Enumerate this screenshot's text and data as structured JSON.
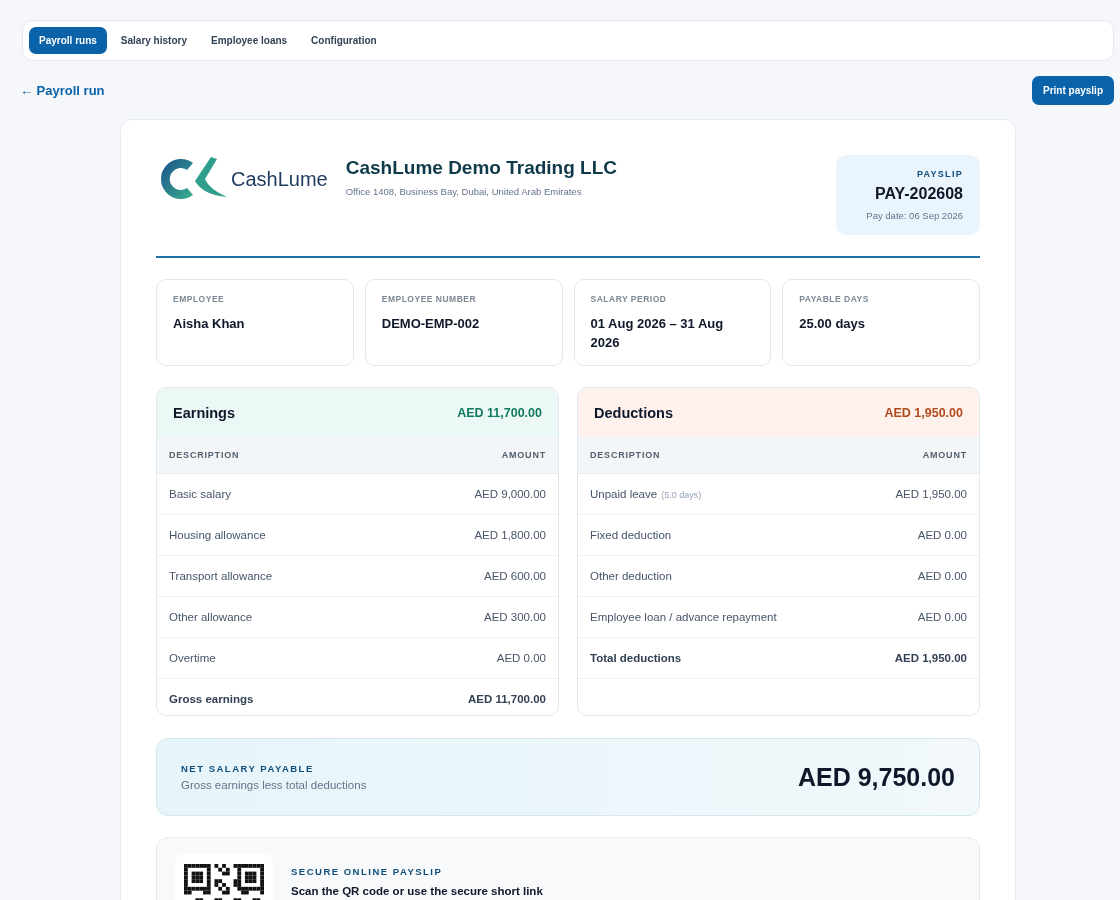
{
  "tabs": [
    {
      "label": "Payroll runs",
      "selected": true
    },
    {
      "label": "Salary history",
      "selected": false
    },
    {
      "label": "Employee loans",
      "selected": false
    },
    {
      "label": "Configuration",
      "selected": false
    }
  ],
  "back_link": "← Payroll run",
  "print_button": "Print payslip",
  "company": {
    "logo_text": "CashLume",
    "name": "CashLume Demo Trading LLC",
    "address": "Office 1408, Business Bay, Dubai, United Arab Emirates"
  },
  "payslip": {
    "label": "PAYSLIP",
    "number": "PAY-202608",
    "pay_date": "Pay date: 06 Sep 2026"
  },
  "info": [
    {
      "label": "EMPLOYEE",
      "value": "Aisha Khan"
    },
    {
      "label": "EMPLOYEE NUMBER",
      "value": "DEMO-EMP-002"
    },
    {
      "label": "SALARY PERIOD",
      "value": "01 Aug 2026 – 31 Aug 2026"
    },
    {
      "label": "PAYABLE DAYS",
      "value": "25.00 days"
    }
  ],
  "panels": [
    {
      "kind": "earnings",
      "title": "Earnings",
      "total": "AED 11,700.00",
      "columns": [
        "DESCRIPTION",
        "AMOUNT"
      ],
      "rows": [
        {
          "kind": "item",
          "description": "Basic salary",
          "amount": "AED 9,000.00"
        },
        {
          "kind": "item",
          "description": "Housing allowance",
          "amount": "AED 1,800.00"
        },
        {
          "kind": "item",
          "description": "Transport allowance",
          "amount": "AED 600.00"
        },
        {
          "kind": "item",
          "description": "Other allowance",
          "amount": "AED 300.00"
        },
        {
          "kind": "item",
          "description": "Overtime",
          "amount": "AED 0.00"
        },
        {
          "kind": "total",
          "description": "Gross earnings",
          "amount": "AED 11,700.00"
        }
      ]
    },
    {
      "kind": "deductions",
      "title": "Deductions",
      "total": "AED 1,950.00",
      "columns": [
        "DESCRIPTION",
        "AMOUNT"
      ],
      "rows": [
        {
          "kind": "item",
          "description": "Unpaid leave",
          "note": "(5.0 days)",
          "amount": "AED 1,950.00"
        },
        {
          "kind": "item",
          "description": "Fixed deduction",
          "amount": "AED 0.00"
        },
        {
          "kind": "item",
          "description": "Other deduction",
          "amount": "AED 0.00"
        },
        {
          "kind": "item",
          "description": "Employee loan / advance repayment",
          "amount": "AED 0.00"
        },
        {
          "kind": "total",
          "description": "Total deductions",
          "amount": "AED 1,950.00"
        }
      ]
    }
  ],
  "net": {
    "label": "NET SALARY PAYABLE",
    "caption": "Gross earnings less total deductions",
    "amount": "AED 9,750.00"
  },
  "online": {
    "label": "SECURE ONLINE PAYSLIP",
    "heading": "Scan the QR code or use the secure short link"
  }
}
